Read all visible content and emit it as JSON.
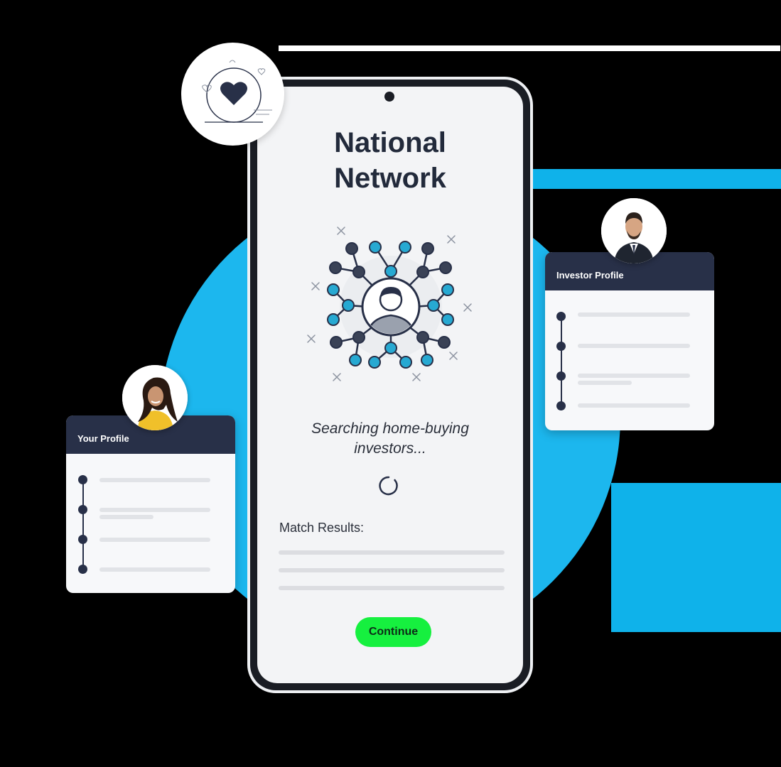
{
  "phone": {
    "title_line1": "National",
    "title_line2": "Network",
    "status_line1": "Searching home-buying",
    "status_line2": "investors...",
    "match_results_label": "Match Results:",
    "continue_label": "Continue"
  },
  "your_profile": {
    "title": "Your Profile"
  },
  "investor_profile": {
    "title": "Investor Profile"
  },
  "icons": [
    "heart-icon",
    "network-icon",
    "loading-spinner-icon",
    "user-avatar"
  ],
  "colors": {
    "accent_blue": "#1cb7ee",
    "navy": "#283048",
    "continue_green": "#16f03f",
    "node_teal": "#27a9d2"
  }
}
